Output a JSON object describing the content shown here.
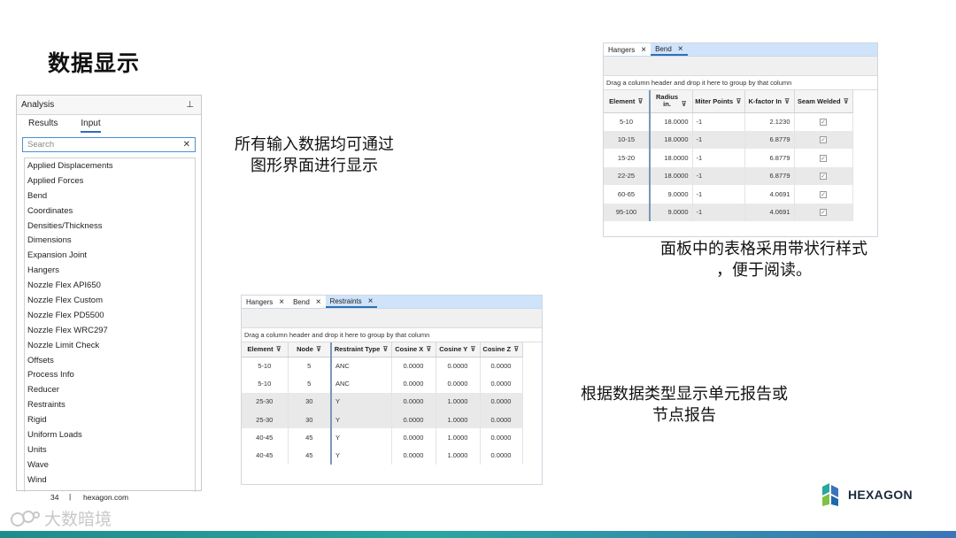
{
  "slide": {
    "title": "数据显示",
    "text1": [
      "所有输入数据均可通过",
      "图形界面进行显示"
    ],
    "text2": [
      "面板中的表格采用带状行样式",
      "，便于阅读。"
    ],
    "text3": [
      "根据数据类型显示单元报告或",
      "节点报告"
    ]
  },
  "analysis_panel": {
    "title": "Analysis",
    "pin_icon": "pin-icon",
    "tabs": [
      "Results",
      "Input"
    ],
    "active_tab": "Input",
    "search_placeholder": "Search",
    "items": [
      "Applied Displacements",
      "Applied Forces",
      "Bend",
      "Coordinates",
      "Densities/Thickness",
      "Dimensions",
      "Expansion Joint",
      "Hangers",
      "Nozzle Flex API650",
      "Nozzle Flex Custom",
      "Nozzle Flex PD5500",
      "Nozzle Flex WRC297",
      "Nozzle Limit Check",
      "Offsets",
      "Process Info",
      "Reducer",
      "Restraints",
      "Rigid",
      "Uniform Loads",
      "Units",
      "Wave",
      "Wind"
    ]
  },
  "grid1": {
    "tabs": [
      {
        "label": "Hangers",
        "active": false
      },
      {
        "label": "Bend",
        "active": true
      }
    ],
    "group_hint": "Drag a column header and drop it here to group by that column",
    "columns": [
      "Element",
      "Radius in.",
      "Miter Points",
      "K-factor In",
      "Seam Welded"
    ],
    "rows": [
      [
        "5-10",
        "18.0000",
        "-1",
        "2.1230",
        true
      ],
      [
        "10-15",
        "18.0000",
        "-1",
        "6.8779",
        true
      ],
      [
        "15-20",
        "18.0000",
        "-1",
        "6.8779",
        true
      ],
      [
        "22-25",
        "18.0000",
        "-1",
        "6.8779",
        true
      ],
      [
        "60-65",
        "9.0000",
        "-1",
        "4.0691",
        true
      ],
      [
        "95-100",
        "9.0000",
        "-1",
        "4.0691",
        true
      ]
    ],
    "banded_rows": [
      1,
      3,
      5
    ]
  },
  "grid2": {
    "tabs": [
      {
        "label": "Hangers",
        "active": false
      },
      {
        "label": "Bend",
        "active": false
      },
      {
        "label": "Restraints",
        "active": true
      }
    ],
    "group_hint": "Drag a column header and drop it here to group by that column",
    "columns": [
      "Element",
      "Node",
      "Restraint Type",
      "Cosine X",
      "Cosine Y",
      "Cosine Z"
    ],
    "rows": [
      [
        "5-10",
        "5",
        "ANC",
        "0.0000",
        "0.0000",
        "0.0000"
      ],
      [
        "5-10",
        "5",
        "ANC",
        "0.0000",
        "0.0000",
        "0.0000"
      ],
      [
        "25-30",
        "30",
        "Y",
        "0.0000",
        "1.0000",
        "0.0000"
      ],
      [
        "25-30",
        "30",
        "Y",
        "0.0000",
        "1.0000",
        "0.0000"
      ],
      [
        "40-45",
        "45",
        "Y",
        "0.0000",
        "1.0000",
        "0.0000"
      ],
      [
        "40-45",
        "45",
        "Y",
        "0.0000",
        "1.0000",
        "0.0000"
      ]
    ],
    "banded_rows": [
      2,
      3
    ]
  },
  "footer": {
    "page_number": "34",
    "separator": "|",
    "site": "hexagon.com",
    "brand": "HEXAGON",
    "watermark": "大数暗境"
  },
  "colors": {
    "accent_blue": "#2f6fb5",
    "tab_bar_blue": "#cfe4fb",
    "band_gray": "#e9e9e9",
    "stripe_teal": "#2aa6a0"
  }
}
